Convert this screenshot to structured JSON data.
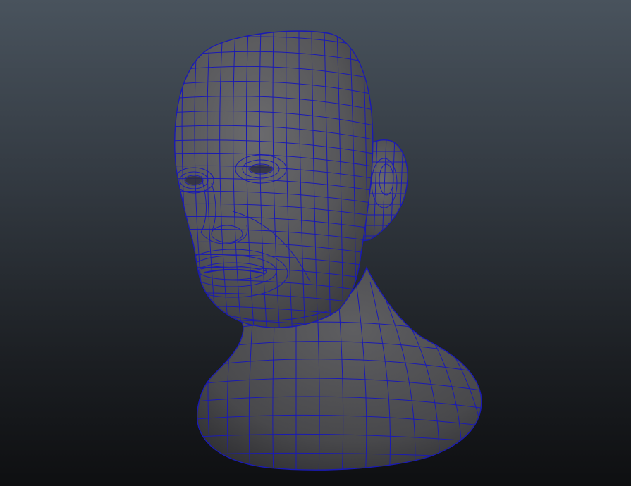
{
  "viewport": {
    "background_top": "#49535d",
    "background_bottom": "#0e0f11"
  },
  "model": {
    "subject": "human-head-bust",
    "display_mode": "wireframe-on-shaded",
    "surface_color": "#5a5a5c",
    "wireframe_color": "#1a1ab4"
  }
}
